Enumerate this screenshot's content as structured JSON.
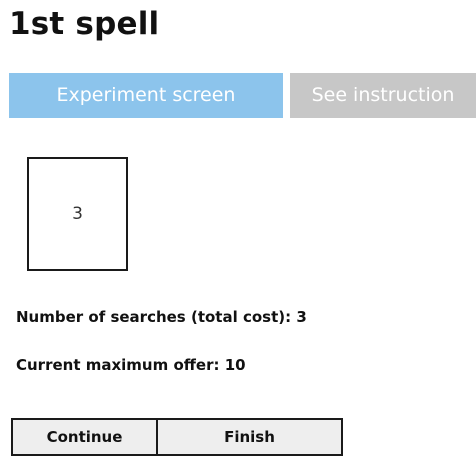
{
  "header": {
    "title": "1st spell"
  },
  "tabs": [
    {
      "label": "Experiment screen",
      "active": true,
      "color": "#8cc4ec"
    },
    {
      "label": "See instruction",
      "active": false,
      "color": "#c7c7c7"
    }
  ],
  "card": {
    "value": "3"
  },
  "info": {
    "searches_text": "Number of searches (total cost): 3",
    "max_offer_text": "Current maximum offer: 10"
  },
  "buttons": {
    "continue_label": "Continue",
    "finish_label": "Finish"
  }
}
